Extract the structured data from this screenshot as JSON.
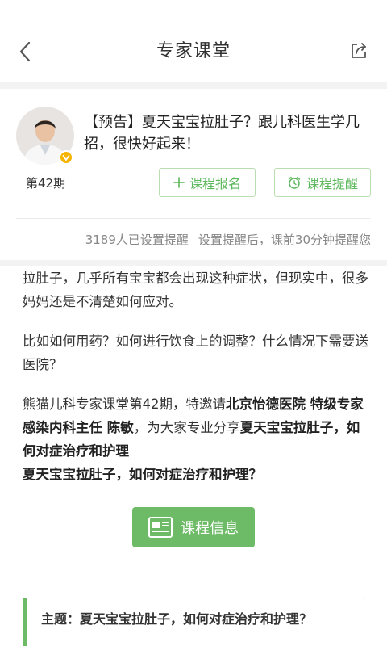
{
  "navbar": {
    "title": "专家课堂",
    "back_icon": "back-chevron-icon",
    "share_icon": "share-icon"
  },
  "course": {
    "title": "【预告】夏天宝宝拉肚子？跟儿科医生学几招，很快好起来！",
    "period": "第42期",
    "enroll_label": "课程报名",
    "remind_label": "课程提醒",
    "remind_count": "3189人已设置提醒",
    "remind_note": "设置提醒后，课前30分钟提醒您"
  },
  "content": {
    "p1": "拉肚子，几乎所有宝宝都会出现这种症状，但现实中，很多妈妈还是不清楚如何应对。",
    "p2": "比如如何用药？如何进行饮食上的调整？什么情况下需要送医院？",
    "p3_a": "熊猫儿科专家课堂第42期，特邀请",
    "p3_b": "北京怡德医院 特级专家 感染内科主任 陈敏",
    "p3_c": "，为大家专业分享",
    "p3_d": "夏天宝宝拉肚子，如何对症治疗和护理",
    "p3_e": "夏天宝宝拉肚子，如何对症治疗和护理？",
    "info_button": "课程信息",
    "topic": "主题：夏天宝宝拉肚子，如何对症治疗和护理？"
  },
  "colors": {
    "accent_green": "#6dbb66",
    "badge_yellow": "#f5b400"
  }
}
